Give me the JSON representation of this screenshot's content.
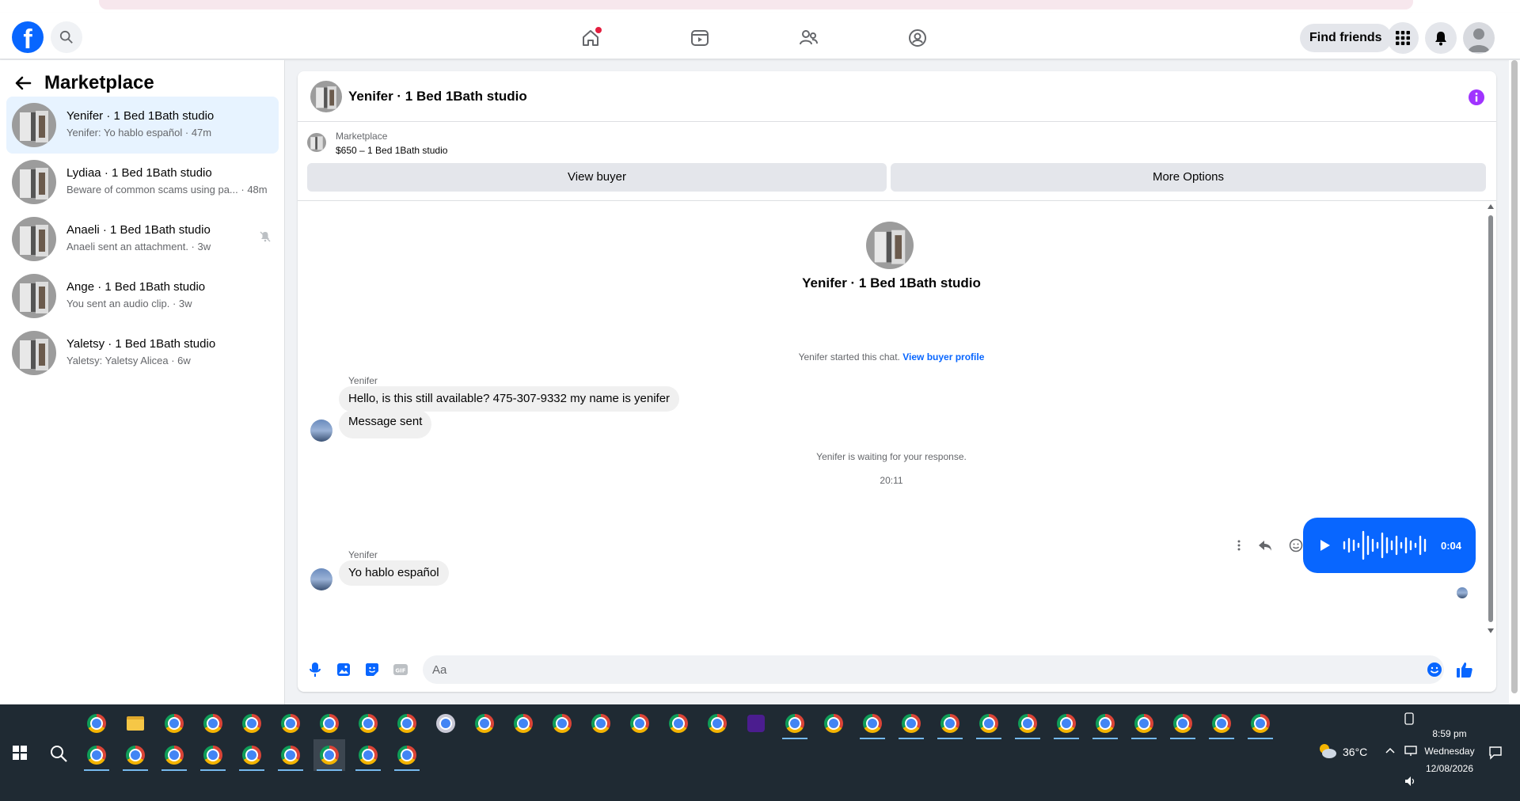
{
  "topnav": {
    "logo": "f",
    "find_friends": "Find friends"
  },
  "sidebar": {
    "title": "Marketplace",
    "conversations": [
      {
        "name": "Yenifer · 1 Bed 1Bath studio",
        "preview": "Yenifer: Yo hablo español · 47m"
      },
      {
        "name": "Lydiaa · 1 Bed 1Bath studio",
        "preview": "Beware of common scams using pa... · 48m"
      },
      {
        "name": "Anaeli · 1 Bed 1Bath studio",
        "preview": "Anaeli sent an attachment. · 3w"
      },
      {
        "name": "Ange · 1 Bed 1Bath studio",
        "preview": "You sent an audio clip. · 3w"
      },
      {
        "name": "Yaletsy · 1 Bed 1Bath studio",
        "preview": "Yaletsy: Yaletsy Alicea · 6w"
      }
    ]
  },
  "chat": {
    "header_title": "Yenifer · 1 Bed 1Bath studio",
    "listing": {
      "source": "Marketplace",
      "price_title": "$650 – 1 Bed 1Bath studio",
      "view_buyer": "View buyer",
      "more_options": "More Options"
    },
    "center_title": "Yenifer · 1 Bed 1Bath studio",
    "started_text": "Yenifer started this chat.",
    "view_profile": "View buyer profile",
    "sender1": "Yenifer",
    "msg1": "Hello, is this still available? 475-307-9332 my name is yenifer",
    "msg2": "Message sent",
    "waiting": "Yenifer is waiting for your response.",
    "timestamp": "20:11",
    "audio_duration": "0:04",
    "sender2": "Yenifer",
    "msg3": "Yo hablo español",
    "composer_placeholder": "Aa"
  },
  "taskbar": {
    "weather": "36°C",
    "time": "8:59 pm",
    "day": "Wednesday",
    "date": "12/08/2026"
  },
  "colors": {
    "fb_blue": "#0866ff",
    "active_item": "#e7f3ff",
    "info_purple": "#a033ff",
    "taskbar": "#1f2a33"
  }
}
